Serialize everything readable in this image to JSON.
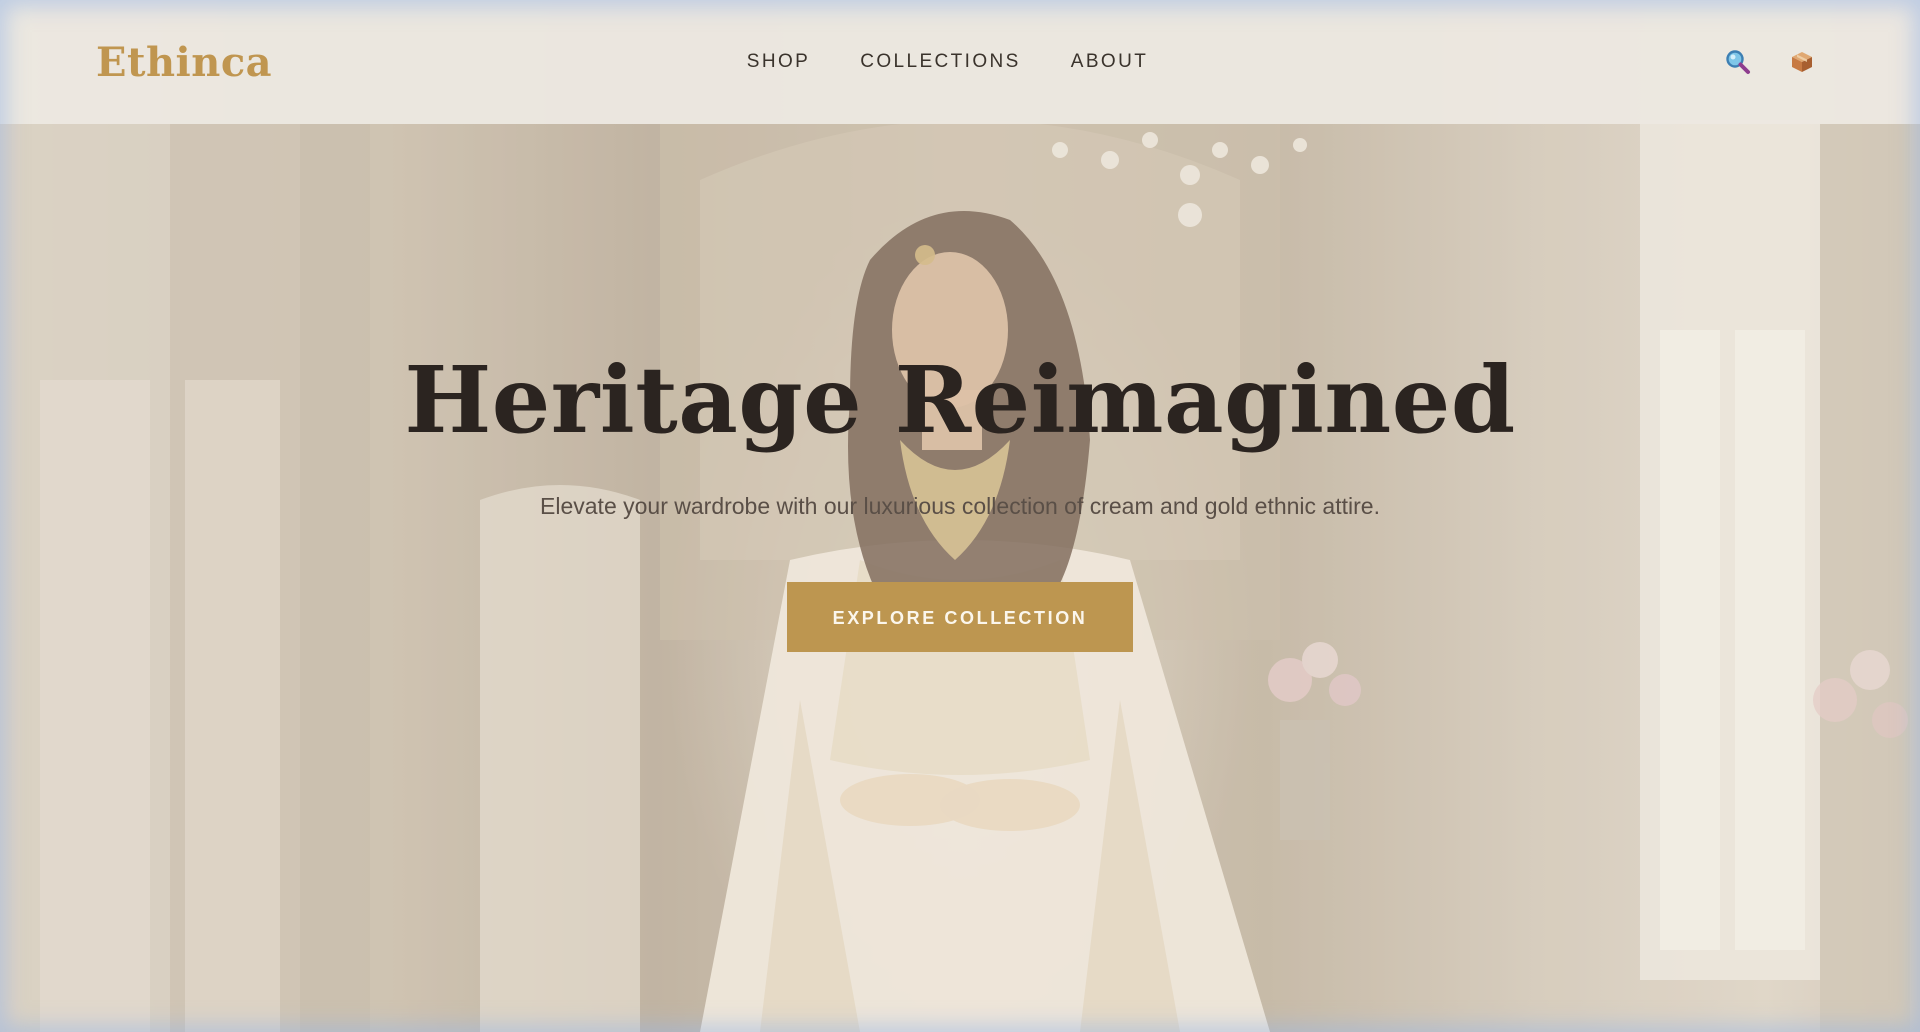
{
  "header": {
    "logo": "Ethinca",
    "nav": [
      {
        "label": "SHOP"
      },
      {
        "label": "COLLECTIONS"
      },
      {
        "label": "ABOUT"
      }
    ],
    "actions": [
      {
        "icon": "search-icon"
      },
      {
        "icon": "package-icon"
      }
    ]
  },
  "hero": {
    "title": "Heritage Reimagined",
    "subtitle": "Elevate your wardrobe with our luxurious collection of cream and gold ethnic attire.",
    "cta_label": "EXPLORE COLLECTION"
  },
  "colors": {
    "brand_gold": "#bd9650",
    "logo_gold": "#c09650",
    "heading": "#2b2420",
    "header_bg": "#ece8e1"
  }
}
